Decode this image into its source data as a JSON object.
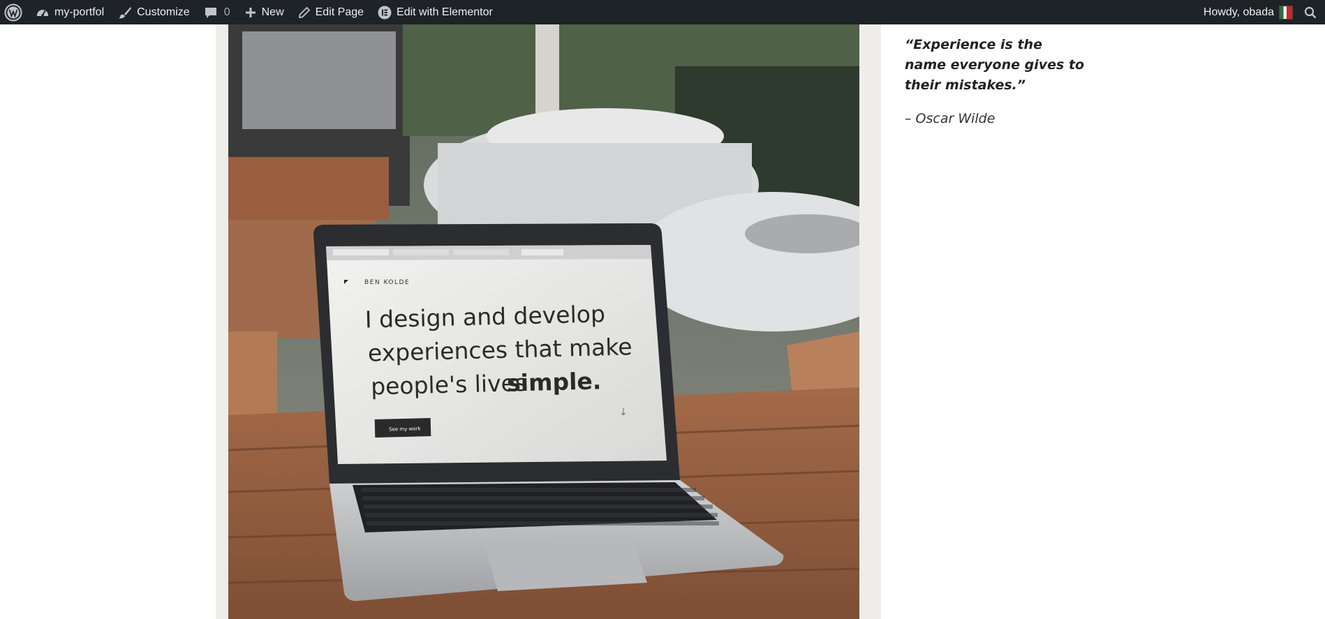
{
  "adminbar": {
    "site_name": "my-portfol",
    "customize": "Customize",
    "comments_count": "0",
    "new": "New",
    "edit_page": "Edit Page",
    "edit_elementor": "Edit with Elementor",
    "howdy": "Howdy, obada",
    "icons": [
      "wordpress-logo-icon",
      "dashboard-icon",
      "brush-icon",
      "comment-icon",
      "plus-icon",
      "pencil-icon",
      "elementor-icon",
      "avatar",
      "search-icon"
    ]
  },
  "photo": {
    "screen_brand": "BEN KOLDE",
    "screen_headline_1": "I design and develop",
    "screen_headline_2": "experiences that make",
    "screen_headline_3": "people's lives",
    "screen_headline_bold": "simple.",
    "screen_button": "See my work"
  },
  "sidebar": {
    "quote": "“Experience is the name everyone gives to their mistakes.”",
    "author": "– Oscar Wilde"
  },
  "colors": {
    "adminbar_bg": "#1d2327",
    "adminbar_text": "#f0f0f1",
    "content_bg": "#efedea",
    "quote_text": "#222222"
  }
}
